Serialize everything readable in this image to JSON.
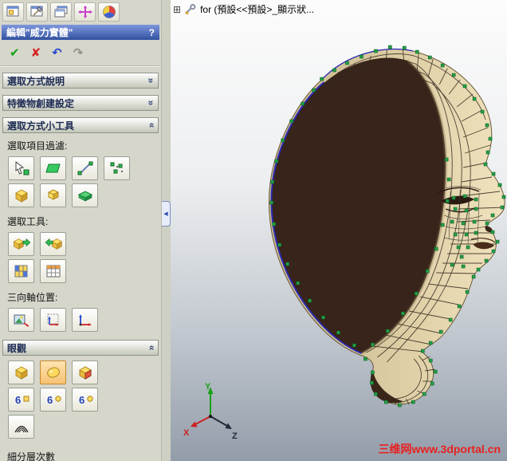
{
  "icons": {
    "check": "✔",
    "cross": "✘",
    "undo": "↶",
    "redo": "↷",
    "chevron": "»",
    "help": "?",
    "tree_expand": "⊞",
    "panel_collapse": "◀",
    "subdiv_glyph": "6"
  },
  "property_panel": {
    "title": "編輯\"威力實體\"",
    "sections": {
      "selection_help": "選取方式說明",
      "feature_settings": "特徵物創建設定",
      "selection_tools": "選取方式小工具",
      "view": "眼觀"
    },
    "labels": {
      "filter": "選取項目過濾:",
      "select_tools": "選取工具:",
      "triad": "三向軸位置:",
      "subdivision": "細分層次數"
    }
  },
  "viewport": {
    "config_text": "for (預設<<預設>_顯示狀...",
    "watermark": "三维网www.3dportal.cn",
    "triad": {
      "x": "X",
      "y": "Y",
      "z": "Z"
    }
  }
}
